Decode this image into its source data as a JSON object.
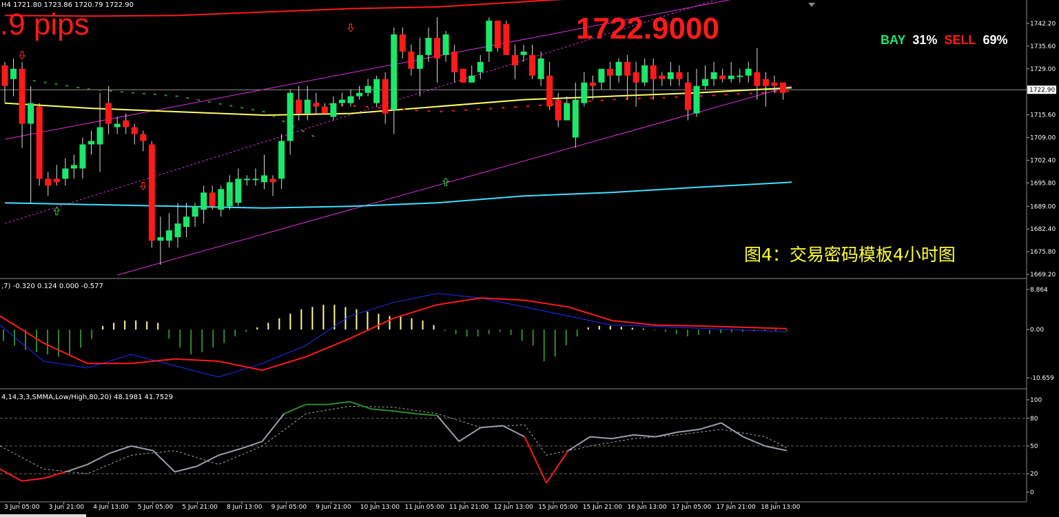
{
  "header": {
    "symbol_timeframe": "H4",
    "ohlc_text": "1721.80 1723.86 1720.79 1722.90",
    "pips_text": ".9 pips",
    "big_price": "1722.9000",
    "bay_label": "BAY",
    "bay_pct": "31%",
    "sell_label": "SELL",
    "sell_pct": "69%",
    "caption": "图4：交易密码模板4小时图"
  },
  "macd_info": ",7) -0.320 0.124 0.000 -0.577",
  "stoch_info": "4,14,3,3,SMMA,Low/High,80,20) 48.1981 41.7529",
  "colors": {
    "bull": "#19e86a",
    "bear": "#ff1a1a",
    "channel": "#e030e0",
    "ma_yellow": "#ffff66",
    "ma_cyan": "#40e0ff",
    "ma_red": "#ff1a1a",
    "macd_pos": "#ffff99",
    "macd_neg": "#2e8b2e",
    "macd_signal": "#ff1a1a",
    "macd_line": "#2030ff",
    "stoch_main": "#9aa0ac",
    "stoch_over": "#2e8b2e",
    "stoch_under": "#ff1a1a"
  },
  "chart_data": [
    {
      "type": "candlestick",
      "price_axis_labels": [
        "1742.20",
        "1735.60",
        "1729.00",
        "1722.90",
        "1715.60",
        "1709.00",
        "1702.40",
        "1695.80",
        "1689.00",
        "1682.40",
        "1675.80",
        "1669.20"
      ],
      "current_price_label": "1722.90",
      "ylim": [
        1668,
        1749
      ],
      "candles": [
        [
          1730,
          1724,
          1731,
          1719
        ],
        [
          1726,
          1729,
          1732,
          1721
        ],
        [
          1729,
          1713,
          1731,
          1706
        ],
        [
          1713,
          1719,
          1724,
          1690
        ],
        [
          1718,
          1697,
          1719,
          1695
        ],
        [
          1697,
          1695,
          1699,
          1692
        ],
        [
          1697,
          1696,
          1701,
          1695
        ],
        [
          1697,
          1700,
          1703,
          1695
        ],
        [
          1700,
          1701,
          1704,
          1697
        ],
        [
          1700,
          1707,
          1709,
          1697
        ],
        [
          1707,
          1708,
          1711,
          1704
        ],
        [
          1707,
          1712,
          1722,
          1699
        ],
        [
          1719,
          1713,
          1724,
          1710
        ],
        [
          1712,
          1713,
          1715,
          1710
        ],
        [
          1714,
          1712,
          1716,
          1710
        ],
        [
          1712,
          1710,
          1713,
          1707
        ],
        [
          1710,
          1708,
          1711,
          1705
        ],
        [
          1707,
          1679,
          1708,
          1677
        ],
        [
          1679,
          1680,
          1686,
          1672
        ],
        [
          1679,
          1682,
          1687,
          1677
        ],
        [
          1680,
          1684,
          1690,
          1677
        ],
        [
          1683,
          1686,
          1690,
          1680
        ],
        [
          1686,
          1689,
          1690,
          1683
        ],
        [
          1688,
          1693,
          1695,
          1684
        ],
        [
          1693,
          1689,
          1695,
          1688
        ],
        [
          1688,
          1694,
          1695,
          1686
        ],
        [
          1689,
          1696,
          1698,
          1688
        ],
        [
          1690,
          1697,
          1700,
          1689
        ],
        [
          1697,
          1697,
          1698,
          1695
        ],
        [
          1697,
          1697,
          1700,
          1695
        ],
        [
          1696,
          1698,
          1704,
          1694
        ],
        [
          1697,
          1696,
          1698,
          1692
        ],
        [
          1697,
          1708,
          1710,
          1694
        ],
        [
          1708,
          1722,
          1723,
          1704
        ],
        [
          1720,
          1716,
          1724,
          1714
        ],
        [
          1716,
          1720,
          1724,
          1714
        ],
        [
          1719,
          1718,
          1722,
          1716
        ],
        [
          1718,
          1716,
          1719,
          1716
        ],
        [
          1715,
          1719,
          1721,
          1714
        ],
        [
          1719,
          1720,
          1722,
          1718
        ],
        [
          1719,
          1721,
          1723,
          1718
        ],
        [
          1721,
          1722,
          1724,
          1720
        ],
        [
          1722,
          1724,
          1726,
          1721
        ],
        [
          1719,
          1726,
          1727,
          1718
        ],
        [
          1726,
          1716,
          1728,
          1713
        ],
        [
          1717,
          1739,
          1741,
          1710
        ],
        [
          1739,
          1734,
          1741,
          1732
        ],
        [
          1734,
          1729,
          1736,
          1727
        ],
        [
          1729,
          1733,
          1738,
          1721
        ],
        [
          1733,
          1738,
          1741,
          1731
        ],
        [
          1738,
          1732,
          1744,
          1725
        ],
        [
          1733,
          1739,
          1740,
          1731
        ],
        [
          1734,
          1728,
          1736,
          1725
        ],
        [
          1729,
          1725,
          1729,
          1725
        ],
        [
          1725,
          1727,
          1730,
          1725
        ],
        [
          1728,
          1731,
          1733,
          1726
        ],
        [
          1734,
          1743,
          1744,
          1731
        ],
        [
          1743,
          1735,
          1743,
          1734
        ],
        [
          1742,
          1733,
          1743,
          1733
        ],
        [
          1733,
          1730,
          1736,
          1726
        ],
        [
          1733,
          1734,
          1736,
          1731
        ],
        [
          1733,
          1727,
          1736,
          1726
        ],
        [
          1726,
          1732,
          1734,
          1724
        ],
        [
          1727,
          1718,
          1731,
          1717
        ],
        [
          1720,
          1714,
          1722,
          1712
        ],
        [
          1714,
          1719,
          1721,
          1715
        ],
        [
          1709,
          1720,
          1725,
          1706
        ],
        [
          1719,
          1725,
          1728,
          1718
        ],
        [
          1725,
          1724,
          1727,
          1720
        ],
        [
          1725,
          1729,
          1729,
          1723
        ],
        [
          1729,
          1727,
          1731,
          1723
        ],
        [
          1727,
          1731,
          1732,
          1725
        ],
        [
          1731,
          1727,
          1733,
          1720
        ],
        [
          1728,
          1725,
          1731,
          1718
        ],
        [
          1725,
          1730,
          1732,
          1724
        ],
        [
          1730,
          1726,
          1732,
          1720
        ],
        [
          1727,
          1726,
          1728,
          1724
        ],
        [
          1726,
          1728,
          1731,
          1724
        ],
        [
          1728,
          1726,
          1730,
          1724
        ],
        [
          1725,
          1717,
          1728,
          1714
        ],
        [
          1716,
          1724,
          1729,
          1715
        ],
        [
          1724,
          1726,
          1730,
          1723
        ],
        [
          1726,
          1728,
          1731,
          1724
        ],
        [
          1727,
          1726,
          1729,
          1725
        ],
        [
          1726,
          1727,
          1731,
          1725
        ],
        [
          1727,
          1727,
          1729,
          1725
        ],
        [
          1727,
          1729,
          1731,
          1725
        ],
        [
          1728,
          1724,
          1735,
          1720
        ],
        [
          1726,
          1724,
          1728,
          1718
        ],
        [
          1725,
          1724,
          1727,
          1722
        ],
        [
          1725,
          1722,
          1725,
          1720
        ]
      ],
      "ma_yellow": [
        [
          0,
          1719
        ],
        [
          10,
          1717.5
        ],
        [
          20,
          1716.5
        ],
        [
          30,
          1715.5
        ],
        [
          40,
          1716
        ],
        [
          50,
          1718
        ],
        [
          60,
          1720
        ],
        [
          70,
          1721
        ],
        [
          80,
          1722
        ],
        [
          91,
          1723.5
        ]
      ],
      "ma_cyan": [
        [
          0,
          1690
        ],
        [
          10,
          1689.5
        ],
        [
          20,
          1689
        ],
        [
          30,
          1688.5
        ],
        [
          40,
          1689
        ],
        [
          50,
          1690
        ],
        [
          60,
          1692
        ],
        [
          70,
          1693
        ],
        [
          80,
          1694.5
        ],
        [
          91,
          1696
        ]
      ],
      "ma_red_top": [
        [
          0,
          1744.5
        ],
        [
          10,
          1744.3
        ],
        [
          20,
          1744.5
        ],
        [
          30,
          1745.5
        ],
        [
          40,
          1746.5
        ],
        [
          50,
          1747
        ],
        [
          60,
          1748.5
        ],
        [
          70,
          1750
        ],
        [
          80,
          1751
        ],
        [
          91,
          1752
        ]
      ],
      "channel_solid_upper": [
        [
          0,
          1708.5
        ],
        [
          91,
          1752.5
        ]
      ],
      "channel_solid_lower": [
        [
          13,
          1669
        ],
        [
          91,
          1724
        ]
      ],
      "channel_dotted": [
        [
          0,
          1684
        ],
        [
          91,
          1756
        ]
      ],
      "dash_green": [
        [
          2,
          1726
        ],
        [
          10,
          1723
        ],
        [
          20,
          1721
        ],
        [
          30,
          1716.5
        ],
        [
          36,
          1709
        ]
      ],
      "dash_red": [
        [
          36,
          1719
        ],
        [
          50,
          1716.5
        ],
        [
          60,
          1718
        ],
        [
          70,
          1720
        ],
        [
          80,
          1721
        ],
        [
          91,
          1722.5
        ]
      ],
      "up_arrows": [
        [
          6,
          1687.5
        ],
        [
          26,
          1692
        ],
        [
          51,
          1696
        ]
      ],
      "down_arrows": [
        [
          2,
          1733
        ],
        [
          16,
          1695
        ],
        [
          40,
          1741
        ]
      ]
    },
    {
      "type": "bar",
      "name": "MACD",
      "axis_labels": [
        "8.864",
        "0.00",
        "-10.659"
      ],
      "ylim": [
        -10.659,
        8.864
      ],
      "histogram": [
        -2.5,
        -3.5,
        -4.5,
        -5,
        -5.5,
        -6,
        -5.5,
        -4,
        -2,
        0.8,
        1.5,
        2,
        2,
        1.8,
        1.5,
        -2,
        -4,
        -5.5,
        -5,
        -4,
        -3,
        -1.5,
        -0.5,
        0.5,
        1.5,
        2.5,
        3.5,
        4.5,
        5,
        5.5,
        5.5,
        5,
        4.5,
        4,
        3.5,
        3,
        3,
        2.5,
        2,
        1,
        -0.3,
        -1,
        -1.5,
        -1.5,
        -1,
        -0.5,
        -1.2,
        -2.5,
        -3.5,
        -7,
        -6,
        -3.5,
        -1.5,
        0.5,
        0.8,
        0.8,
        0.6,
        0.4,
        0.2,
        -0.2,
        -0.5,
        -1,
        -1.5,
        -1.2,
        -1,
        -0.8,
        -0.6,
        -0.5,
        -0.4,
        -0.3,
        -0.3,
        -0.3
      ],
      "signal": [
        [
          0,
          3
        ],
        [
          5,
          -3
        ],
        [
          10,
          -7.5
        ],
        [
          15,
          -7.5
        ],
        [
          20,
          -6.5
        ],
        [
          25,
          -7
        ],
        [
          30,
          -9
        ],
        [
          35,
          -6
        ],
        [
          40,
          -2
        ],
        [
          45,
          2.5
        ],
        [
          50,
          5.5
        ],
        [
          55,
          7
        ],
        [
          60,
          6.5
        ],
        [
          65,
          5
        ],
        [
          70,
          2
        ],
        [
          75,
          1
        ],
        [
          80,
          0.8
        ],
        [
          90,
          0.2
        ]
      ],
      "macd": [
        [
          0,
          1
        ],
        [
          5,
          -7
        ],
        [
          10,
          -8.5
        ],
        [
          15,
          -5.5
        ],
        [
          20,
          -8
        ],
        [
          25,
          -10.5
        ],
        [
          30,
          -7.5
        ],
        [
          35,
          -3.5
        ],
        [
          40,
          3
        ],
        [
          45,
          6
        ],
        [
          50,
          8
        ],
        [
          55,
          7
        ],
        [
          60,
          5
        ],
        [
          65,
          3
        ],
        [
          70,
          1
        ],
        [
          75,
          0.7
        ],
        [
          80,
          0.3
        ],
        [
          90,
          -0.5
        ]
      ]
    },
    {
      "type": "line",
      "name": "Stochastic",
      "axis_labels": [
        "100",
        "80",
        "50",
        "20",
        "0"
      ],
      "ylim": [
        0,
        100
      ],
      "levels": [
        80,
        50,
        20
      ],
      "main": [
        [
          0,
          25
        ],
        [
          2,
          12
        ],
        [
          4,
          15
        ],
        [
          6,
          22
        ],
        [
          8,
          30
        ],
        [
          10,
          42
        ],
        [
          12,
          50
        ],
        [
          14,
          45
        ],
        [
          16,
          22
        ],
        [
          18,
          28
        ],
        [
          20,
          40
        ],
        [
          22,
          47
        ],
        [
          24,
          55
        ],
        [
          26,
          85
        ],
        [
          28,
          95
        ],
        [
          30,
          95
        ],
        [
          32,
          98
        ],
        [
          34,
          90
        ],
        [
          36,
          88
        ],
        [
          38,
          85
        ],
        [
          40,
          83
        ],
        [
          42,
          55
        ],
        [
          44,
          70
        ],
        [
          46,
          72
        ],
        [
          48,
          60
        ],
        [
          50,
          10
        ],
        [
          52,
          45
        ],
        [
          54,
          60
        ],
        [
          56,
          58
        ],
        [
          58,
          62
        ],
        [
          60,
          60
        ],
        [
          62,
          65
        ],
        [
          64,
          68
        ],
        [
          66,
          75
        ],
        [
          68,
          60
        ],
        [
          70,
          50
        ],
        [
          72,
          45
        ]
      ],
      "signal": [
        [
          0,
          50
        ],
        [
          4,
          25
        ],
        [
          8,
          20
        ],
        [
          12,
          40
        ],
        [
          16,
          45
        ],
        [
          20,
          30
        ],
        [
          24,
          50
        ],
        [
          28,
          85
        ],
        [
          32,
          93
        ],
        [
          36,
          92
        ],
        [
          40,
          85
        ],
        [
          44,
          70
        ],
        [
          48,
          73
        ],
        [
          50,
          40
        ],
        [
          54,
          50
        ],
        [
          58,
          58
        ],
        [
          62,
          62
        ],
        [
          66,
          68
        ],
        [
          70,
          60
        ],
        [
          72,
          48
        ]
      ],
      "date_labels": [
        "3 Jun 05:00",
        "3 Jun 21:00",
        "4 Jun 13:00",
        "5 Jun 05:00",
        "5 Jun 21:00",
        "8 Jun 13:00",
        "9 Jun 05:00",
        "9 Jun 21:00",
        "10 Jun 13:00",
        "11 Jun 05:00",
        "11 Jun 21:00",
        "12 Jun 13:00",
        "15 Jun 05:00",
        "15 Jun 21:00",
        "16 Jun 13:00",
        "17 Jun 05:00",
        "17 Jun 21:00",
        "18 Jun 13:00"
      ]
    }
  ]
}
